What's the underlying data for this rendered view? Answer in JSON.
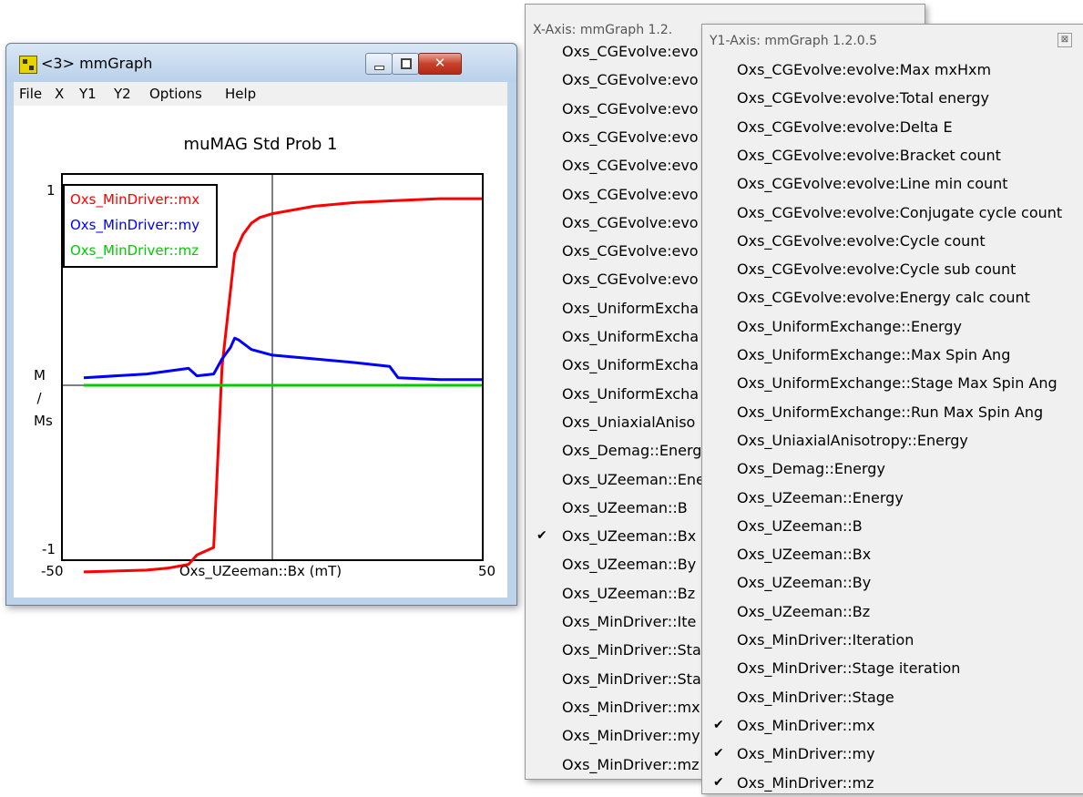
{
  "window": {
    "title": "<3> mmGraph",
    "close_glyph": "✕",
    "menu": [
      "File",
      "X",
      "Y1",
      "Y2",
      "Options",
      "Help"
    ]
  },
  "plot": {
    "title": "muMAG Std Prob 1",
    "y_label": "M / Ms",
    "y_ticks": [
      "1",
      "-1"
    ],
    "x_tick_min": "-50",
    "x_tick_max": "50",
    "x_label": "Oxs_UZeeman::Bx (mT)",
    "legend": [
      {
        "label": "Oxs_MinDriver::mx",
        "color": "#ff0000"
      },
      {
        "label": "Oxs_MinDriver::my",
        "color": "#0000ff"
      },
      {
        "label": "Oxs_MinDriver::mz",
        "color": "#00cc00"
      }
    ]
  },
  "chart_data": {
    "type": "line",
    "title": "muMAG Std Prob 1",
    "xlabel": "Oxs_UZeeman::Bx (mT)",
    "ylabel": "M/Ms",
    "xlim": [
      -50,
      50
    ],
    "ylim": [
      -1,
      1
    ],
    "series": [
      {
        "name": "Oxs_MinDriver::mx",
        "color": "#ff0000",
        "x": [
          -45,
          -30,
          -25,
          -20,
          -18,
          -14,
          -12,
          -10,
          -9,
          -8,
          -7,
          -5,
          -3,
          0,
          10,
          20,
          30,
          40,
          50
        ],
        "y": [
          -0.99,
          -0.98,
          -0.97,
          -0.95,
          -0.9,
          -0.86,
          0.1,
          0.5,
          0.7,
          0.75,
          0.8,
          0.86,
          0.89,
          0.91,
          0.95,
          0.97,
          0.98,
          0.99,
          0.99
        ]
      },
      {
        "name": "Oxs_MinDriver::my",
        "color": "#0000ff",
        "x": [
          -45,
          -30,
          -20,
          -18,
          -14,
          -12,
          -10,
          -9,
          -8,
          -5,
          0,
          10,
          20,
          28,
          30,
          40,
          50
        ],
        "y": [
          0.04,
          0.06,
          0.09,
          0.05,
          0.06,
          0.14,
          0.2,
          0.25,
          0.24,
          0.19,
          0.16,
          0.14,
          0.12,
          0.1,
          0.04,
          0.03,
          0.03
        ]
      },
      {
        "name": "Oxs_MinDriver::mz",
        "color": "#00cc00",
        "x": [
          -45,
          50
        ],
        "y": [
          0.0,
          0.0
        ]
      }
    ]
  },
  "x_menu": {
    "title": "X-Axis: mmGraph 1.2.",
    "items": [
      {
        "label": "Oxs_CGEvolve:evo",
        "checked": false
      },
      {
        "label": "Oxs_CGEvolve:evo",
        "checked": false
      },
      {
        "label": "Oxs_CGEvolve:evo",
        "checked": false
      },
      {
        "label": "Oxs_CGEvolve:evo",
        "checked": false
      },
      {
        "label": "Oxs_CGEvolve:evo",
        "checked": false
      },
      {
        "label": "Oxs_CGEvolve:evo",
        "checked": false
      },
      {
        "label": "Oxs_CGEvolve:evo",
        "checked": false
      },
      {
        "label": "Oxs_CGEvolve:evo",
        "checked": false
      },
      {
        "label": "Oxs_CGEvolve:evo",
        "checked": false
      },
      {
        "label": "Oxs_UniformExcha",
        "checked": false
      },
      {
        "label": "Oxs_UniformExcha",
        "checked": false
      },
      {
        "label": "Oxs_UniformExcha",
        "checked": false
      },
      {
        "label": "Oxs_UniformExcha",
        "checked": false
      },
      {
        "label": "Oxs_UniaxialAniso",
        "checked": false
      },
      {
        "label": "Oxs_Demag::Energ",
        "checked": false
      },
      {
        "label": "Oxs_UZeeman::Ene",
        "checked": false
      },
      {
        "label": "Oxs_UZeeman::B",
        "checked": false
      },
      {
        "label": "Oxs_UZeeman::Bx",
        "checked": true
      },
      {
        "label": "Oxs_UZeeman::By",
        "checked": false
      },
      {
        "label": "Oxs_UZeeman::Bz",
        "checked": false
      },
      {
        "label": "Oxs_MinDriver::Ite",
        "checked": false
      },
      {
        "label": "Oxs_MinDriver::Sta",
        "checked": false
      },
      {
        "label": "Oxs_MinDriver::Sta",
        "checked": false
      },
      {
        "label": "Oxs_MinDriver::mx",
        "checked": false
      },
      {
        "label": "Oxs_MinDriver::my",
        "checked": false
      },
      {
        "label": "Oxs_MinDriver::mz",
        "checked": false
      }
    ]
  },
  "y1_menu": {
    "title": "Y1-Axis: mmGraph 1.2.0.5",
    "close_glyph": "⊠",
    "items": [
      {
        "label": "Oxs_CGEvolve:evolve:Max mxHxm",
        "checked": false
      },
      {
        "label": "Oxs_CGEvolve:evolve:Total energy",
        "checked": false
      },
      {
        "label": "Oxs_CGEvolve:evolve:Delta E",
        "checked": false
      },
      {
        "label": "Oxs_CGEvolve:evolve:Bracket count",
        "checked": false
      },
      {
        "label": "Oxs_CGEvolve:evolve:Line min count",
        "checked": false
      },
      {
        "label": "Oxs_CGEvolve:evolve:Conjugate cycle count",
        "checked": false
      },
      {
        "label": "Oxs_CGEvolve:evolve:Cycle count",
        "checked": false
      },
      {
        "label": "Oxs_CGEvolve:evolve:Cycle sub count",
        "checked": false
      },
      {
        "label": "Oxs_CGEvolve:evolve:Energy calc count",
        "checked": false
      },
      {
        "label": "Oxs_UniformExchange::Energy",
        "checked": false
      },
      {
        "label": "Oxs_UniformExchange::Max Spin Ang",
        "checked": false
      },
      {
        "label": "Oxs_UniformExchange::Stage Max Spin Ang",
        "checked": false
      },
      {
        "label": "Oxs_UniformExchange::Run Max Spin Ang",
        "checked": false
      },
      {
        "label": "Oxs_UniaxialAnisotropy::Energy",
        "checked": false
      },
      {
        "label": "Oxs_Demag::Energy",
        "checked": false
      },
      {
        "label": "Oxs_UZeeman::Energy",
        "checked": false
      },
      {
        "label": "Oxs_UZeeman::B",
        "checked": false
      },
      {
        "label": "Oxs_UZeeman::Bx",
        "checked": false
      },
      {
        "label": "Oxs_UZeeman::By",
        "checked": false
      },
      {
        "label": "Oxs_UZeeman::Bz",
        "checked": false
      },
      {
        "label": "Oxs_MinDriver::Iteration",
        "checked": false
      },
      {
        "label": "Oxs_MinDriver::Stage iteration",
        "checked": false
      },
      {
        "label": "Oxs_MinDriver::Stage",
        "checked": false
      },
      {
        "label": "Oxs_MinDriver::mx",
        "checked": true
      },
      {
        "label": "Oxs_MinDriver::my",
        "checked": true
      },
      {
        "label": "Oxs_MinDriver::mz",
        "checked": true
      }
    ]
  },
  "checkmark": "✔"
}
